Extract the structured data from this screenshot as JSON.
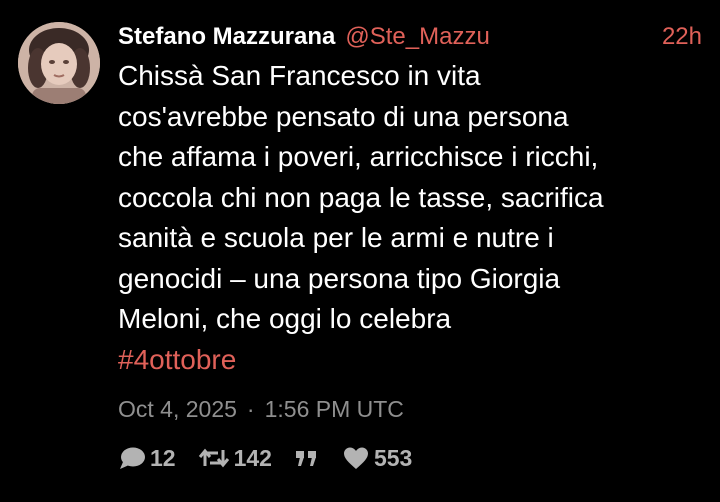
{
  "tweet": {
    "display_name": "Stefano Mazzurana",
    "handle": "@Ste_Mazzu",
    "relative_time": "22h",
    "body_lines": [
      "Chissà San Francesco in vita",
      "cos'avrebbe pensato di una persona",
      "che affama i poveri, arricchisce i ricchi,",
      "coccola chi non paga le tasse, sacrifica",
      "sanità e scuola per le armi e nutre i",
      "genocidi – una persona tipo Giorgia",
      "Meloni, che oggi lo celebra"
    ],
    "hashtag": "#4ottobre",
    "date": "Oct 4, 2025",
    "separator": "·",
    "time": "1:56 PM UTC"
  },
  "actions": {
    "reply_icon": "speech-bubble-icon",
    "reply_count": "12",
    "retweet_icon": "retweet-arrows-icon",
    "retweet_count": "142",
    "quote_icon": "quote-marks-icon",
    "like_icon": "heart-icon",
    "like_count": "553"
  },
  "colors": {
    "background": "#000000",
    "text": "#ffffff",
    "accent": "#e06159",
    "muted": "#8f8f8f",
    "icon": "#b3b3b3"
  }
}
